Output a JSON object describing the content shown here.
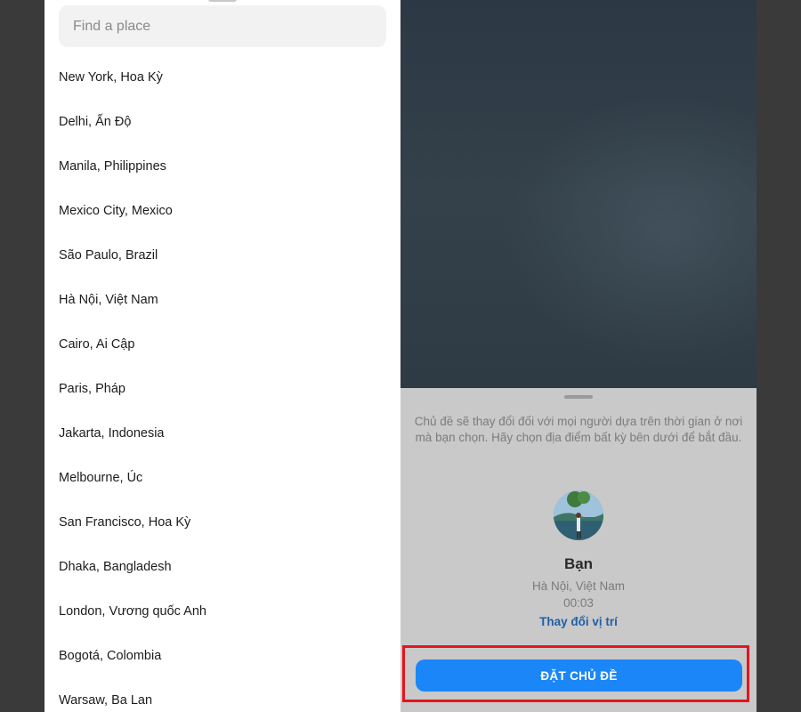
{
  "search": {
    "placeholder": "Find a place",
    "value": ""
  },
  "places": [
    "New York, Hoa Kỳ",
    "Delhi, Ấn Độ",
    "Manila, Philippines",
    "Mexico City, Mexico",
    "São Paulo, Brazil",
    "Hà Nội, Việt Nam",
    "Cairo, Ai Cập",
    "Paris, Pháp",
    "Jakarta, Indonesia",
    "Melbourne, Úc",
    "San Francisco, Hoa Kỳ",
    "Dhaka, Bangladesh",
    "London, Vương quốc Anh",
    "Bogotá, Colombia",
    "Warsaw, Ba Lan"
  ],
  "preview": {
    "description": "Chủ đề sẽ thay đổi đối với mọi người dựa trên thời gian ở nơi mà bạn chọn. Hãy chọn địa điểm bất kỳ bên dưới để bắt đầu.",
    "user_name": "Bạn",
    "user_location": "Hà Nội, Việt Nam",
    "user_time": "00:03",
    "change_location_label": "Thay đổi vị trí",
    "set_theme_label": "ĐẶT CHỦ ĐỀ"
  },
  "colors": {
    "accent": "#1b86f7",
    "link": "#1f5fa8",
    "highlight": "#e5141c"
  }
}
